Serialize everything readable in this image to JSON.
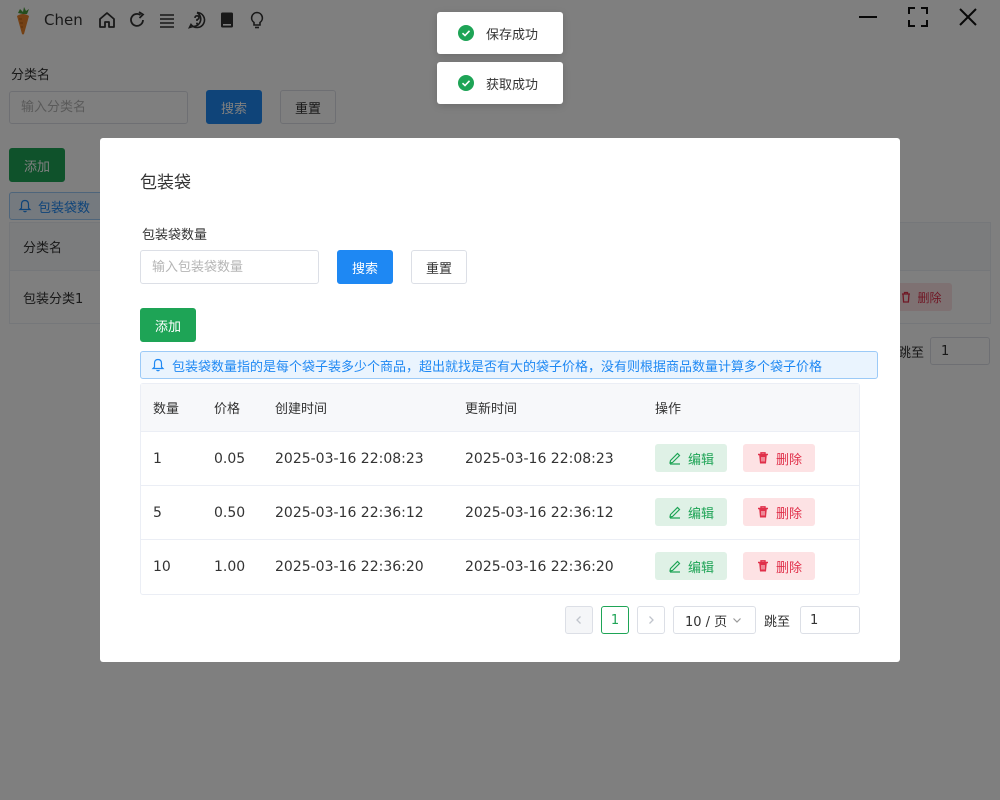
{
  "app": {
    "name": "Chen",
    "toolbar_icons": [
      "home-icon",
      "refresh-icon",
      "menu-icon",
      "help-icon",
      "book-icon",
      "lightbulb-icon"
    ],
    "window_controls": [
      "minimize-icon",
      "fullscreen-icon",
      "close-icon"
    ]
  },
  "background": {
    "filter_label": "分类名",
    "filter_placeholder": "输入分类名",
    "search_label": "搜索",
    "reset_label": "重置",
    "add_label": "添加",
    "alert_text": "包装袋数",
    "table_header": "分类名",
    "row_name": "包装分类1",
    "delete_label": "删除",
    "jump_label": "跳至",
    "jump_value": "1"
  },
  "modal": {
    "title": "包装袋",
    "filter_label": "包装袋数量",
    "filter_placeholder": "输入包装袋数量",
    "search_label": "搜索",
    "reset_label": "重置",
    "add_label": "添加",
    "alert_text": "包装袋数量指的是每个袋子装多少个商品，超出就找是否有大的袋子价格，没有则根据商品数量计算多个袋子价格",
    "columns": [
      "数量",
      "价格",
      "创建时间",
      "更新时间",
      "操作"
    ],
    "rows": [
      {
        "qty": "1",
        "price": "0.05",
        "created": "2025-03-16 22:08:23",
        "updated": "2025-03-16 22:08:23"
      },
      {
        "qty": "5",
        "price": "0.50",
        "created": "2025-03-16 22:36:12",
        "updated": "2025-03-16 22:36:12"
      },
      {
        "qty": "10",
        "price": "1.00",
        "created": "2025-03-16 22:36:20",
        "updated": "2025-03-16 22:36:20"
      }
    ],
    "edit_label": "编辑",
    "delete_label": "删除",
    "pagination": {
      "current_page": "1",
      "page_size": "10 / 页",
      "jump_label": "跳至",
      "jump_value": "1"
    }
  },
  "toasts": [
    {
      "text": "保存成功",
      "status": "success"
    },
    {
      "text": "获取成功",
      "status": "success"
    }
  ],
  "colors": {
    "primary": "#1e88f3",
    "success": "#1ea456",
    "danger": "#e0304a",
    "overlay": "rgba(0,0,0,0.5)"
  }
}
